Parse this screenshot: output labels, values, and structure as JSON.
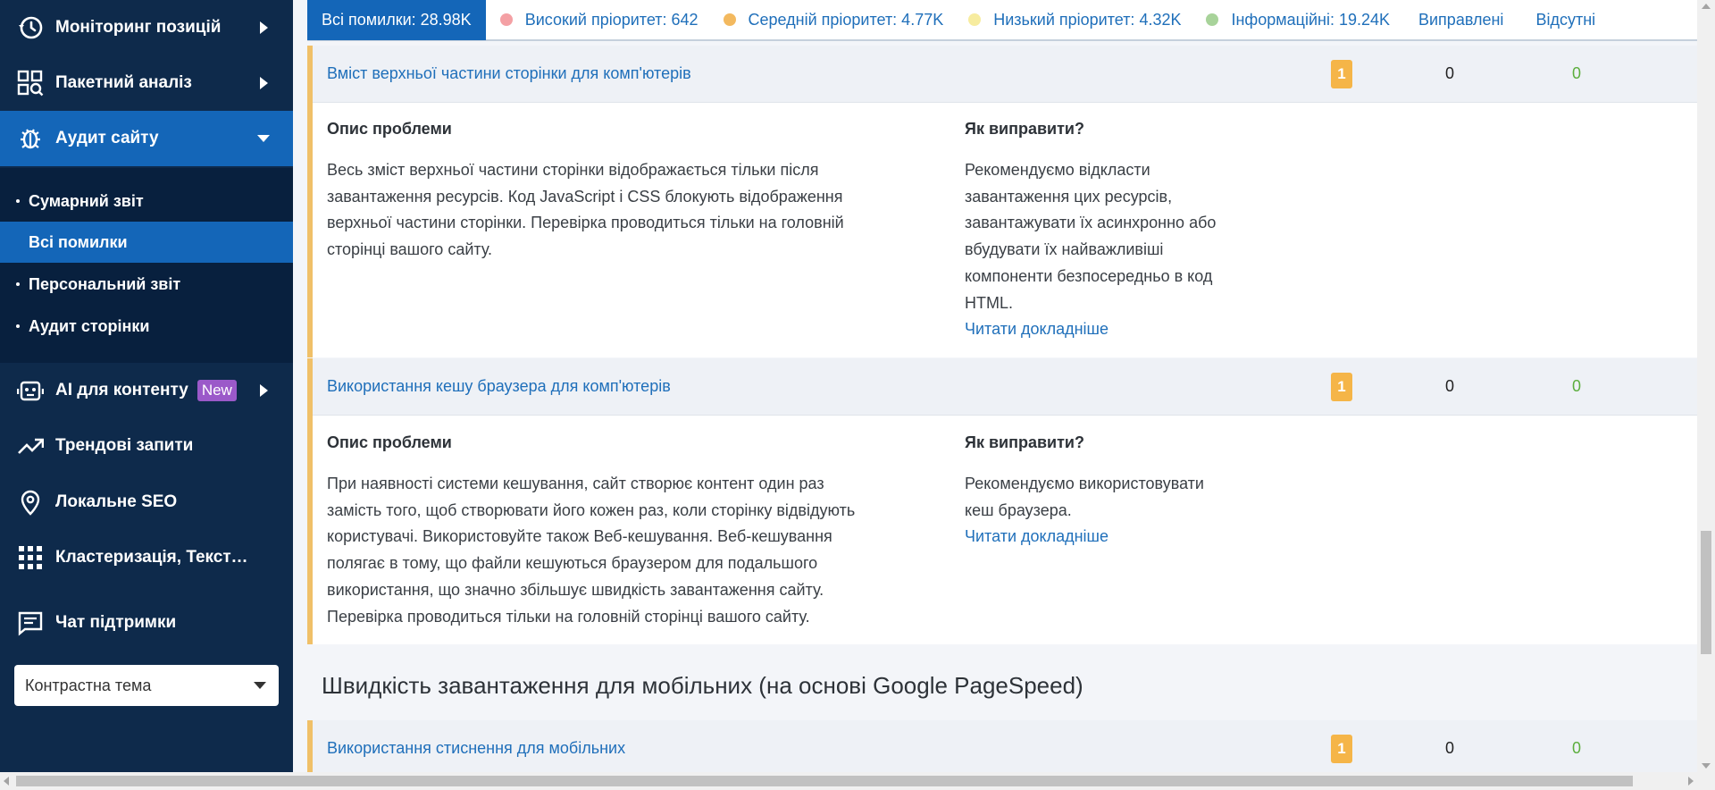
{
  "sidebar": {
    "nav": [
      {
        "label": "Моніторинг позицій",
        "icon": "history-icon"
      },
      {
        "label": "Пакетний аналіз",
        "icon": "grid-search-icon"
      },
      {
        "label": "Аудит сайту",
        "icon": "bug-icon"
      },
      {
        "label": "AI для контенту",
        "icon": "robot-icon",
        "badge": "New"
      },
      {
        "label": "Трендові запити",
        "icon": "trend-icon"
      },
      {
        "label": "Локальне SEO",
        "icon": "map-pin-icon"
      },
      {
        "label": "Кластеризація, Текстова ...",
        "icon": "apps-grid-icon"
      },
      {
        "label": "Чат підтримки",
        "icon": "chat-icon"
      }
    ],
    "sub_items": [
      {
        "label": "Сумарний звіт"
      },
      {
        "label": "Всі помилки",
        "active": true
      },
      {
        "label": "Персональний звіт"
      },
      {
        "label": "Аудит сторінки"
      }
    ],
    "theme_select": {
      "value": "Контрастна тема"
    }
  },
  "filters": [
    {
      "label": "Всі помилки: 28.98K",
      "active": true
    },
    {
      "label": "Високий пріоритет: 642",
      "color": "#f4a0a4"
    },
    {
      "label": "Середній пріоритет: 4.77K",
      "color": "#f3b95f"
    },
    {
      "label": "Низький пріоритет: 4.32K",
      "color": "#f7ec9f"
    },
    {
      "label": "Інформаційні: 19.24K",
      "color": "#a8d39a"
    },
    {
      "label": "Виправлені"
    },
    {
      "label": "Відсутні"
    }
  ],
  "issues": [
    {
      "title": "Вміст верхньої частини сторінки для комп'ютерів",
      "badge": "1",
      "count_mid": "0",
      "count_green": "0",
      "desc_heading": "Опис проблеми",
      "desc_lines": [
        "Весь зміст верхньої частини сторінки відображається тільки після",
        "завантаження ресурсів. Код JavaScript і CSS блокують відображення",
        "верхньої частини сторінки. Перевірка проводиться тільки на головній",
        "сторінці вашого сайту."
      ],
      "fix_heading": "Як виправити?",
      "fix_lines": [
        "Рекомендуємо відкласти",
        "завантаження цих ресурсів,",
        "завантажувати їх асинхронно або",
        "вбудувати їх найважливіші",
        "компоненти безпосередньо в код",
        "HTML."
      ],
      "read_more": "Читати докладніше"
    },
    {
      "title": "Використання кешу браузера для комп'ютерів",
      "badge": "1",
      "count_mid": "0",
      "count_green": "0",
      "desc_heading": "Опис проблеми",
      "desc_lines": [
        "При наявності системи кешування, сайт створює контент один раз",
        "замість того, щоб створювати його кожен раз, коли сторінку відвідують",
        "користувачі. Використовуйте також Веб-кешування. Веб-кешування",
        "полягає в тому, що файли кешуються браузером для подальшого",
        "використання, що значно збільшує швидкість завантаження сайту.",
        "Перевірка проводиться тільки на головній сторінці вашого сайту."
      ],
      "fix_heading": "Як виправити?",
      "fix_lines": [
        "Рекомендуємо використовувати",
        "кеш браузера."
      ],
      "read_more": "Читати докладніше"
    }
  ],
  "section": {
    "title": "Швидкість завантаження для мобільних (на основі Google PageSpeed)"
  },
  "mobile_issue": {
    "title": "Використання стиснення для мобільних",
    "badge": "1",
    "count_mid": "0",
    "count_green": "0"
  }
}
